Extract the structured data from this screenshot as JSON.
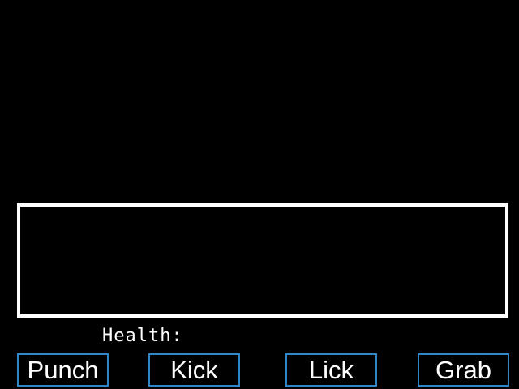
{
  "hud": {
    "health_label": "Health:"
  },
  "actions": [
    {
      "label": "Punch"
    },
    {
      "label": "Kick"
    },
    {
      "label": "Lick"
    },
    {
      "label": "Grab"
    }
  ],
  "colors": {
    "background": "#000000",
    "dialog_border": "#ffffff",
    "button_border": "#2f86c8",
    "text": "#ffffff"
  }
}
